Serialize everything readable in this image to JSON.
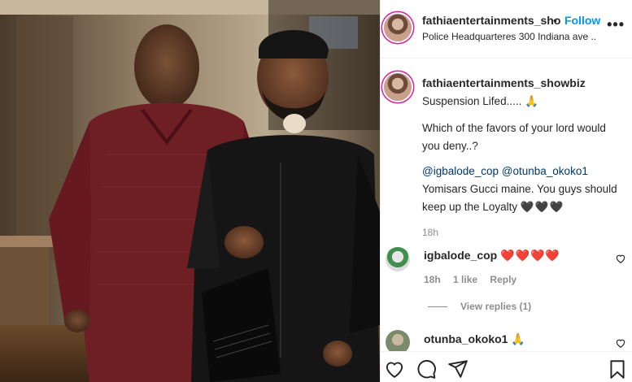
{
  "post": {
    "username": "fathiaentertainments_sho",
    "dot": "•",
    "follow_label": "Follow",
    "location": "Police Headquarteres 300 Indiana ave ...",
    "more_label": "•••"
  },
  "caption": {
    "username": "fathiaentertainments_showbiz",
    "line1": "Suspension Lifed.....",
    "line1_emoji": "🙏",
    "line2": "Which of the favors of your lord would",
    "line3": "you deny..?",
    "mention1": "@igbalode_cop",
    "mention2": "@otunba_okoko1",
    "line5": "Yomisars Gucci maine. You guys should",
    "line6": "keep up the Loyalty",
    "line6_emoji": "🖤🖤🖤",
    "time": "18h"
  },
  "comments": [
    {
      "username": "igbalode_cop",
      "text": "❤️❤️❤️❤️",
      "time": "18h",
      "likes": "1 like",
      "reply_label": "Reply",
      "view_replies": "View replies (1)"
    },
    {
      "username": "otunba_okoko1",
      "text": "🙏"
    }
  ],
  "icons": {
    "like": "heart-icon",
    "comment": "comment-icon",
    "share": "share-icon",
    "save": "bookmark-icon"
  },
  "colors": {
    "follow": "#0095f6",
    "mention": "#00376b",
    "meta": "#8e8e8e",
    "heart": "#ed4956"
  }
}
